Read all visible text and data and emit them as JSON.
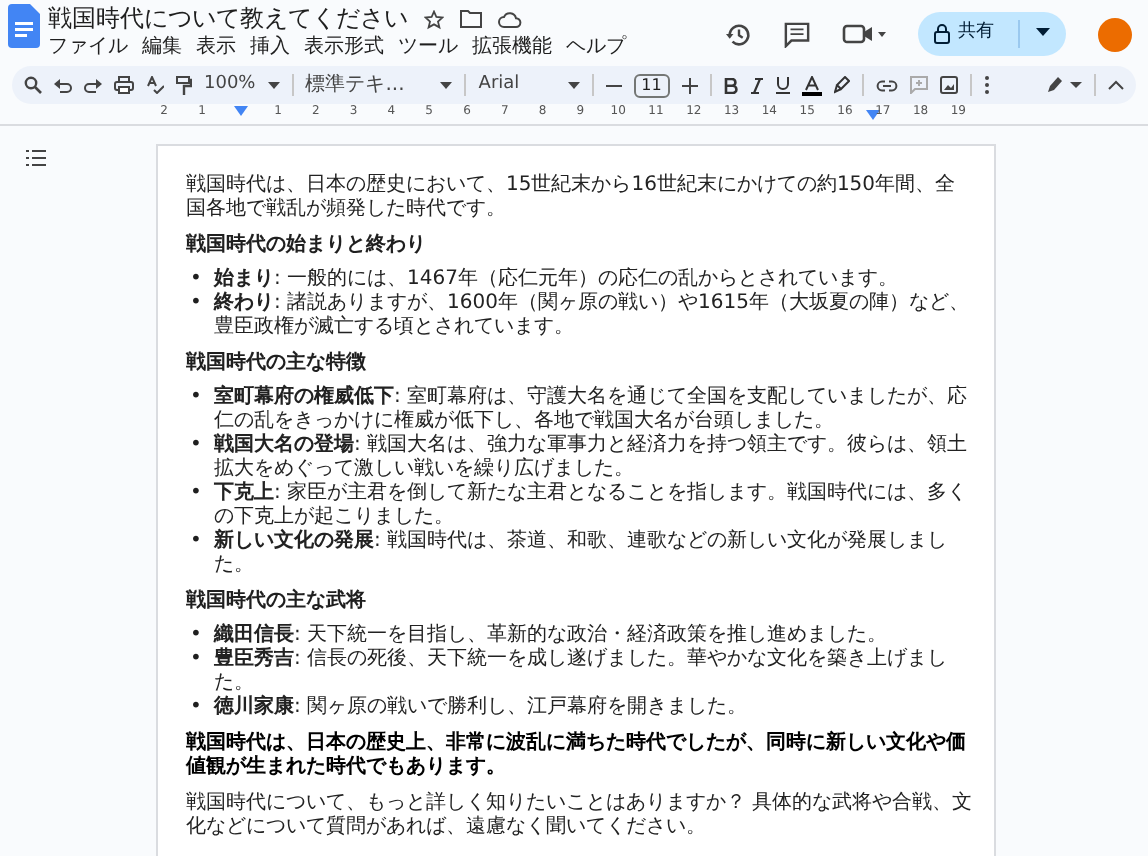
{
  "window": {
    "title": "戦国時代について教えてください"
  },
  "menu": [
    "ファイル",
    "編集",
    "表示",
    "挿入",
    "表示形式",
    "ツール",
    "拡張機能",
    "ヘルプ"
  ],
  "share_button": {
    "label": "共有"
  },
  "toolbar": {
    "zoom": "100%",
    "style": "標準テキ...",
    "font": "Arial",
    "font_size": "11"
  },
  "ruler": {
    "ticks": [
      "2",
      "1",
      "1",
      "2",
      "3",
      "4",
      "5",
      "6",
      "7",
      "8",
      "9",
      "10",
      "11",
      "12",
      "13",
      "14",
      "15",
      "16",
      "17",
      "18",
      "19"
    ]
  },
  "document": {
    "blocks": [
      {
        "kind": "paragraph",
        "text": "戦国時代は、日本の歴史において、15世紀末から16世紀末にかけての約150年間、全国各地で戦乱が頻発した時代です。"
      },
      {
        "kind": "heading",
        "text": "戦国時代の始まりと終わり"
      },
      {
        "kind": "list",
        "marker": "•",
        "items": [
          "**始まり**: 一般的には、1467年（応仁元年）の応仁の乱からとされています。",
          "**終わり**: 諸説ありますが、1600年（関ヶ原の戦い）や1615年（大坂夏の陣）など、豊臣政権が滅亡する頃とされています。"
        ]
      },
      {
        "kind": "heading",
        "text": "戦国時代の主な特徴"
      },
      {
        "kind": "list",
        "marker": "•",
        "items": [
          "**室町幕府の権威低下**: 室町幕府は、守護大名を通じて全国を支配していましたが、応仁の乱をきっかけに権威が低下し、各地で戦国大名が台頭しました。",
          "**戦国大名の登場**: 戦国大名は、強力な軍事力と経済力を持つ領主です。彼らは、領土拡大をめぐって激しい戦いを繰り広げました。",
          "**下克上**: 家臣が主君を倒して新たな主君となることを指します。戦国時代には、多くの下克上が起こりました。",
          "**新しい文化の発展**: 戦国時代は、茶道、和歌、連歌などの新しい文化が発展しました。"
        ]
      },
      {
        "kind": "heading",
        "text": "戦国時代の主な武将"
      },
      {
        "kind": "list",
        "marker": "•",
        "items": [
          "**織田信長**: 天下統一を目指し、革新的な政治・経済政策を推し進めました。",
          "**豊臣秀吉**: 信長の死後、天下統一を成し遂げました。華やかな文化を築き上げました。",
          "**徳川家康**: 関ヶ原の戦いで勝利し、江戸幕府を開きました。"
        ]
      },
      {
        "kind": "emphasis",
        "text": "戦国時代は、日本の歴史上、非常に波乱に満ちた時代でしたが、同時に新しい文化や価値観が生まれた時代でもあります。"
      },
      {
        "kind": "paragraph",
        "text": "戦国時代について、もっと詳しく知りたいことはありますか？ 具体的な武将や合戦、文化などについて質問があれば、遠慮なく聞いてください。"
      }
    ]
  }
}
